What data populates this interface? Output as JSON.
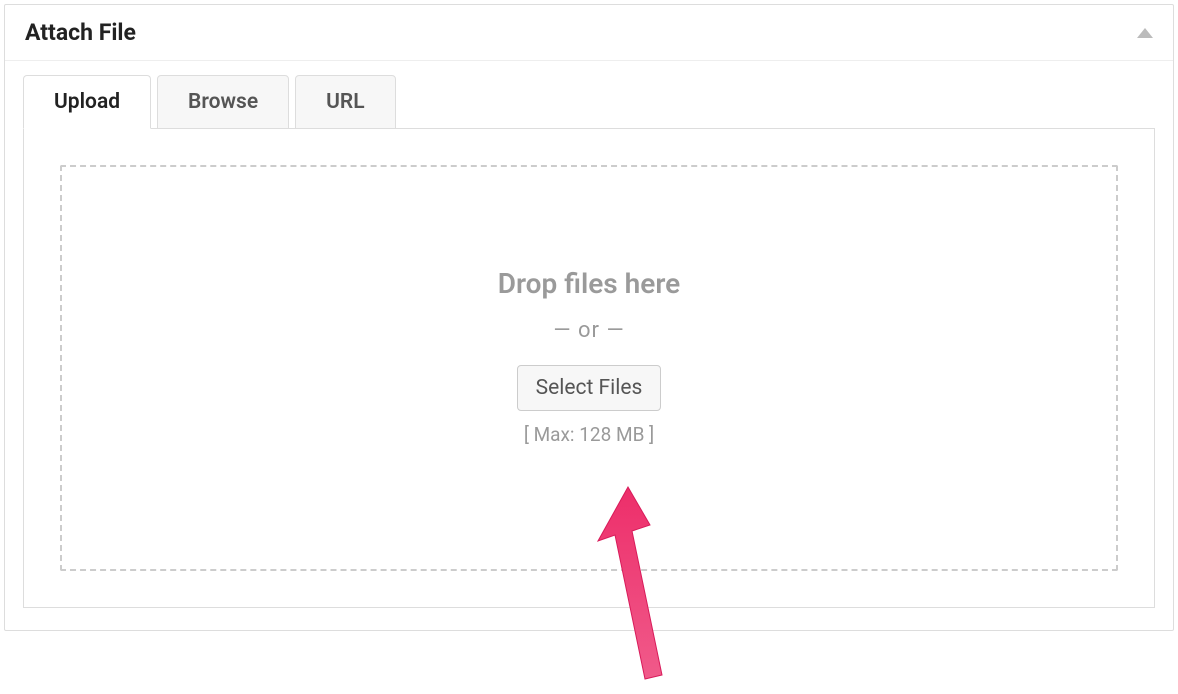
{
  "panel": {
    "title": "Attach File"
  },
  "tabs": {
    "upload": "Upload",
    "browse": "Browse",
    "url": "URL"
  },
  "dropzone": {
    "drop_text": "Drop files here",
    "or_text": "—  or  —",
    "select_button": "Select Files",
    "max_text": "[ Max: 128 MB ]"
  },
  "annotation": {
    "arrow_color": "#ed2e6a"
  }
}
